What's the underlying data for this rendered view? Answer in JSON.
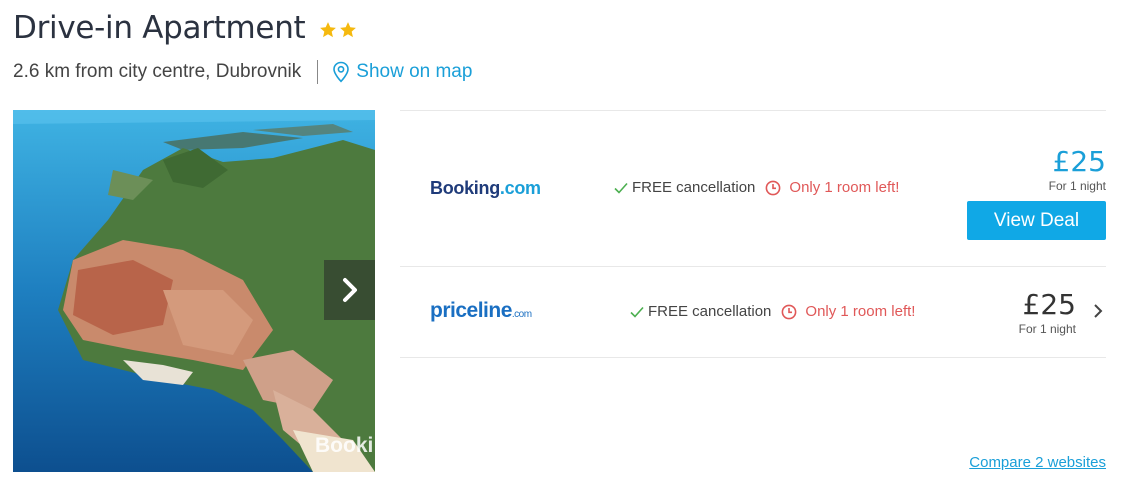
{
  "hotel": {
    "name": "Drive-in Apartment",
    "stars": 2,
    "location": "2.6 km from city centre, Dubrovnik",
    "map_link": "Show on map"
  },
  "photo": {
    "watermark": "Booki"
  },
  "deals": [
    {
      "provider": "Booking.com",
      "logo_main": "Booking",
      "logo_suffix": ".com",
      "free_cancellation": "FREE cancellation",
      "availability": "Only 1 room left!",
      "price": "£25",
      "price_note": "For 1 night",
      "cta": "View Deal",
      "price_color": "#1a9fd8"
    },
    {
      "provider": "priceline.com",
      "logo_main": "priceline",
      "logo_suffix": ".com",
      "free_cancellation": "FREE cancellation",
      "availability": "Only 1 room left!",
      "price": "£25",
      "price_note": "For 1 night",
      "price_color": "#333333"
    }
  ],
  "compare_link": "Compare 2 websites",
  "colors": {
    "accent": "#1a9fd8",
    "button": "#10a8e6",
    "warning": "#e05858",
    "check": "#4caf50",
    "star": "#f5b90f"
  }
}
